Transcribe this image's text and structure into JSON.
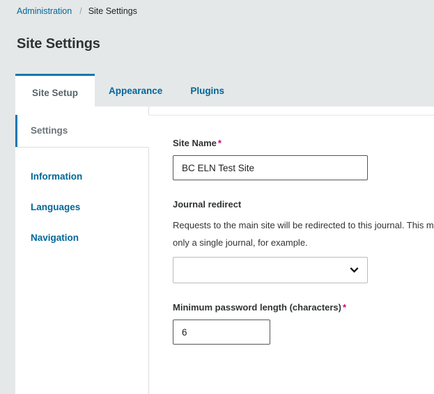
{
  "breadcrumb": {
    "parent_label": "Administration",
    "separator": "/",
    "current_label": "Site Settings"
  },
  "page_title": "Site Settings",
  "tabs": [
    {
      "label": "Site Setup",
      "active": true
    },
    {
      "label": "Appearance",
      "active": false
    },
    {
      "label": "Plugins",
      "active": false
    }
  ],
  "subnav": [
    {
      "label": "Settings",
      "active": true
    },
    {
      "label": "Information",
      "active": false
    },
    {
      "label": "Languages",
      "active": false
    },
    {
      "label": "Navigation",
      "active": false
    }
  ],
  "form": {
    "site_name": {
      "label": "Site Name",
      "required_marker": "*",
      "value": "BC ELN Test Site",
      "placeholder": ""
    },
    "journal_redirect": {
      "label": "Journal redirect",
      "description": "Requests to the main site will be redirected to this journal. This may be useful if the site hosts only a single journal, for example.",
      "value": "",
      "placeholder": ""
    },
    "min_password_length": {
      "label": "Minimum password length (characters)",
      "required_marker": "*",
      "value": "6",
      "placeholder": ""
    }
  },
  "icons": {
    "chevron_down": "chevron-down-icon"
  },
  "colors": {
    "accent_blue": "#007ab2",
    "link_blue": "#006798",
    "required_pink": "#d0006f",
    "page_bg": "#e4e8e9",
    "panel_bg": "#ffffff"
  }
}
